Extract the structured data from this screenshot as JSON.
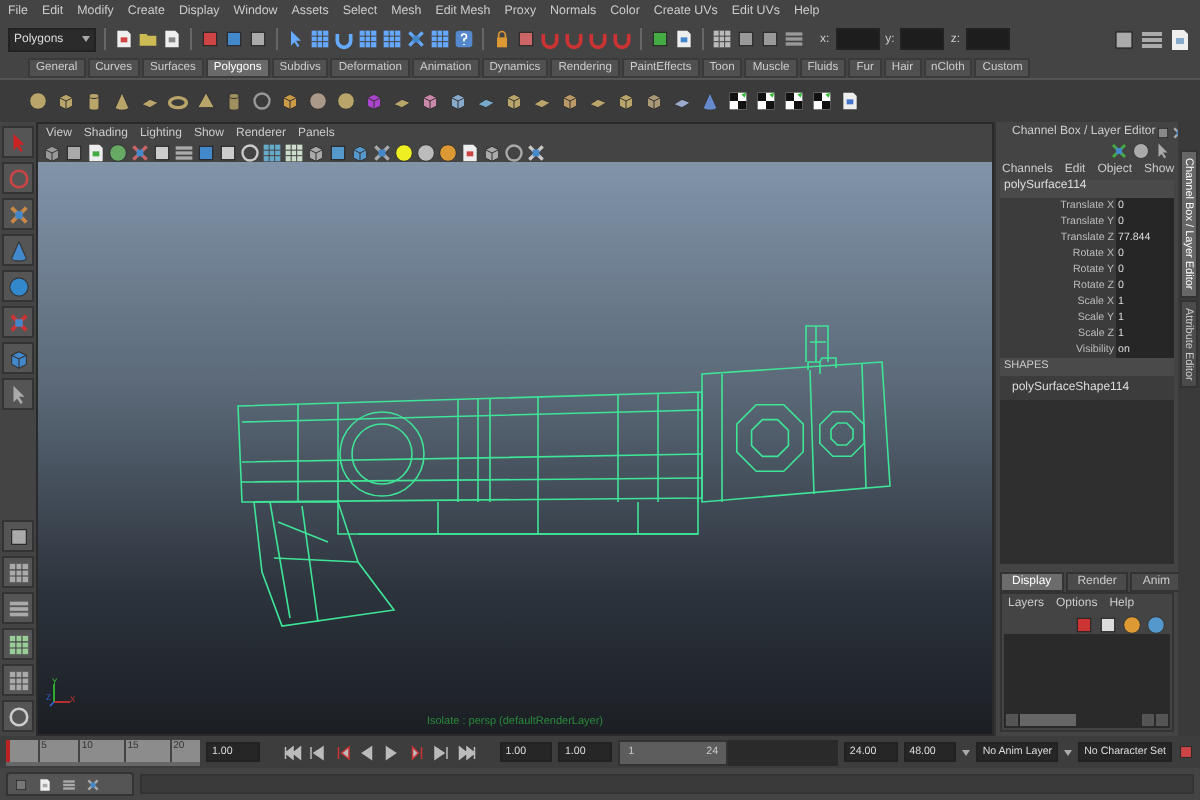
{
  "menu_bar": [
    "File",
    "Edit",
    "Modify",
    "Create",
    "Display",
    "Window",
    "Assets",
    "Select",
    "Mesh",
    "Edit Mesh",
    "Proxy",
    "Normals",
    "Color",
    "Create UVs",
    "Edit UVs",
    "Help"
  ],
  "status_line": {
    "mode": "Polygons",
    "fields": [
      "x:",
      "y:",
      "z:"
    ]
  },
  "shelf_tabs": [
    {
      "label": "General",
      "selected": false
    },
    {
      "label": "Curves",
      "selected": false
    },
    {
      "label": "Surfaces",
      "selected": false
    },
    {
      "label": "Polygons",
      "selected": true
    },
    {
      "label": "Subdivs",
      "selected": false
    },
    {
      "label": "Deformation",
      "selected": false
    },
    {
      "label": "Animation",
      "selected": false
    },
    {
      "label": "Dynamics",
      "selected": false
    },
    {
      "label": "Rendering",
      "selected": false
    },
    {
      "label": "PaintEffects",
      "selected": false
    },
    {
      "label": "Toon",
      "selected": false
    },
    {
      "label": "Muscle",
      "selected": false
    },
    {
      "label": "Fluids",
      "selected": false
    },
    {
      "label": "Fur",
      "selected": false
    },
    {
      "label": "Hair",
      "selected": false
    },
    {
      "label": "nCloth",
      "selected": false
    },
    {
      "label": "Custom",
      "selected": false
    }
  ],
  "viewport": {
    "menu": [
      "View",
      "Shading",
      "Lighting",
      "Show",
      "Renderer",
      "Panels"
    ],
    "axes": [
      "Y",
      "Z",
      "X"
    ],
    "hud": "Isolate : persp (defaultRenderLayer)"
  },
  "channel_box": {
    "title": "Channel Box / Layer Editor",
    "menu": [
      "Channels",
      "Edit",
      "Object",
      "Show"
    ],
    "object": "polySurface114",
    "attributes": [
      {
        "name": "Translate X",
        "value": "0"
      },
      {
        "name": "Translate Y",
        "value": "0"
      },
      {
        "name": "Translate Z",
        "value": "77.844"
      },
      {
        "name": "Rotate X",
        "value": "0"
      },
      {
        "name": "Rotate Y",
        "value": "0"
      },
      {
        "name": "Rotate Z",
        "value": "0"
      },
      {
        "name": "Scale X",
        "value": "1"
      },
      {
        "name": "Scale Y",
        "value": "1"
      },
      {
        "name": "Scale Z",
        "value": "1"
      },
      {
        "name": "Visibility",
        "value": "on"
      }
    ],
    "shapes_heading": "SHAPES",
    "shape": "polySurfaceShape114"
  },
  "side_tabs": [
    {
      "label": "Channel Box / Layer Editor",
      "selected": true
    },
    {
      "label": "Attribute Editor",
      "selected": false
    }
  ],
  "layer_editor": {
    "tabs": [
      {
        "label": "Display",
        "selected": true
      },
      {
        "label": "Render",
        "selected": false
      },
      {
        "label": "Anim",
        "selected": false
      }
    ],
    "menu": [
      "Layers",
      "Options",
      "Help"
    ]
  },
  "time_slider": {
    "ticks": [
      "5",
      "10",
      "15",
      "20"
    ],
    "level": 0,
    "current_time": "1.00"
  },
  "range_slider": {
    "start_time": "1.00",
    "start_range": "1.00",
    "range_start": "1",
    "range_end": "24",
    "level": 0.5,
    "end_range": "24.00",
    "end_time": "48.00"
  },
  "anim_layer": "No Anim Layer",
  "character_set": "No Character Set"
}
